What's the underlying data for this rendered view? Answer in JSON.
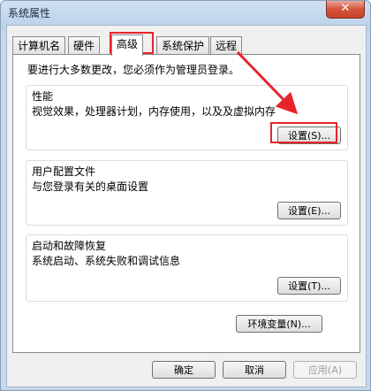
{
  "window": {
    "title": "系统属性",
    "close_glyph": "✕"
  },
  "tabs": [
    {
      "label": "计算机名"
    },
    {
      "label": "硬件"
    },
    {
      "label": "高级"
    },
    {
      "label": "系统保护"
    },
    {
      "label": "远程"
    }
  ],
  "active_tab": "高级",
  "notice": "要进行大多数更改，您必须作为管理员登录。",
  "performance": {
    "title": "性能",
    "desc": "视觉效果，处理器计划，内存使用，以及及虚拟内存",
    "button": "设置(S)..."
  },
  "profiles": {
    "title": "用户配置文件",
    "desc": "与您登录有关的桌面设置",
    "button": "设置(E)..."
  },
  "startup": {
    "title": "启动和故障恢复",
    "desc": "系统启动、系统失败和调试信息",
    "button": "设置(T)..."
  },
  "env_button": "环境变量(N)...",
  "footer": {
    "ok": "确定",
    "cancel": "取消",
    "apply": "应用(A)"
  },
  "colors": {
    "highlight": "#e8242b"
  }
}
